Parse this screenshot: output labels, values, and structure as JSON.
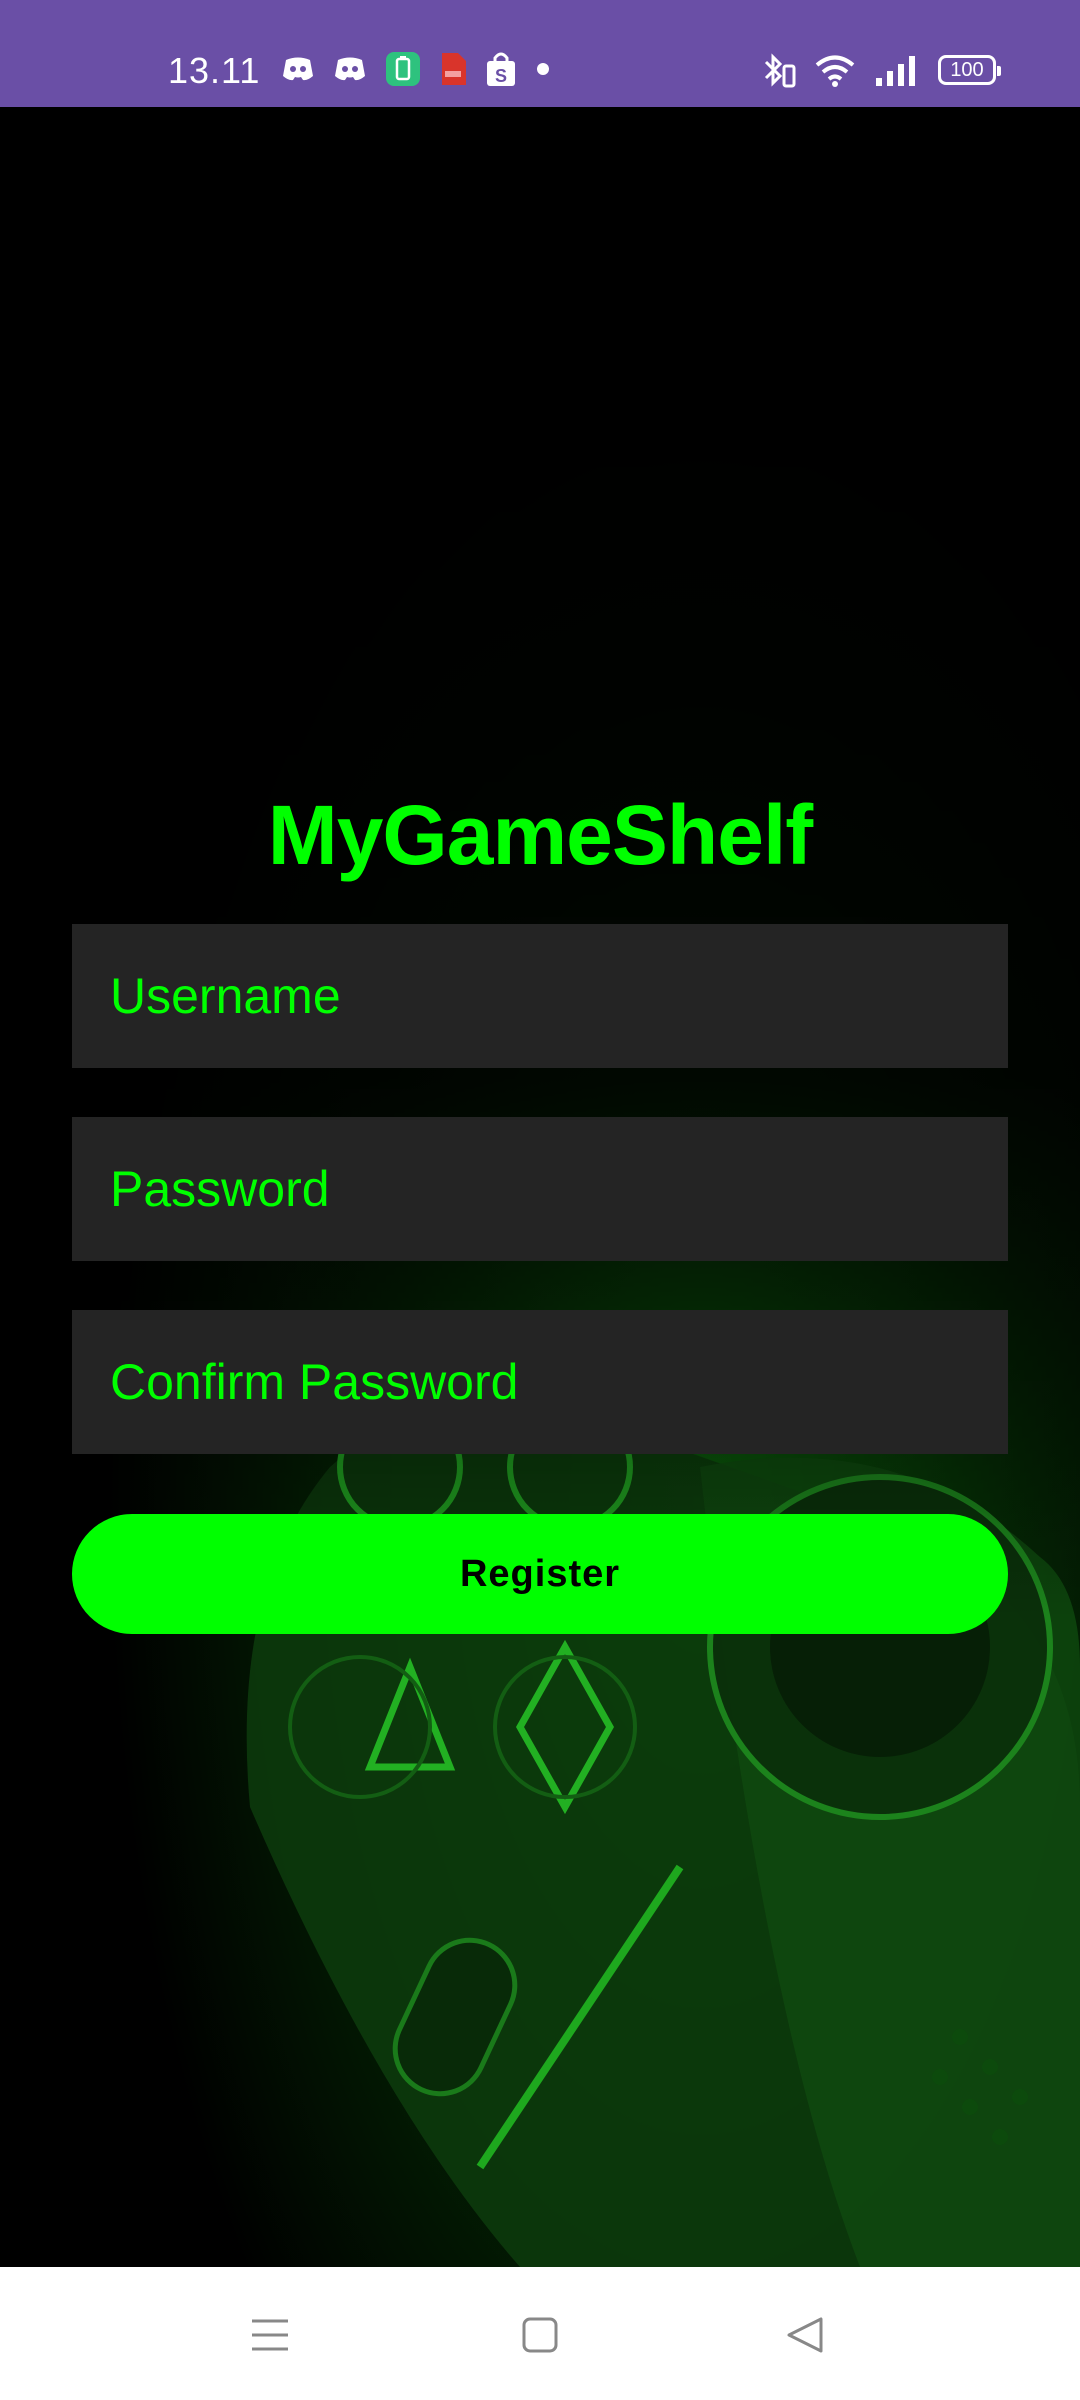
{
  "status_bar": {
    "time": "13.11",
    "battery_level": "100",
    "left_icons": [
      "discord-icon",
      "discord-icon",
      "battery-saver-icon",
      "pdf-app-icon",
      "shopping-bag-icon",
      "dot-icon"
    ],
    "right_icons": [
      "bluetooth-icon",
      "wifi-icon",
      "signal-icon",
      "battery-icon"
    ],
    "background_color": "#6a4fa6"
  },
  "app": {
    "title": "MyGameShelf",
    "username_placeholder": "Username",
    "password_placeholder": "Password",
    "confirm_password_placeholder": "Confirm Password",
    "register_label": "Register",
    "accent_color": "#00ff00",
    "field_color": "#242424"
  },
  "nav_bar": {
    "buttons": [
      "menu-icon",
      "home-icon",
      "back-icon"
    ]
  }
}
